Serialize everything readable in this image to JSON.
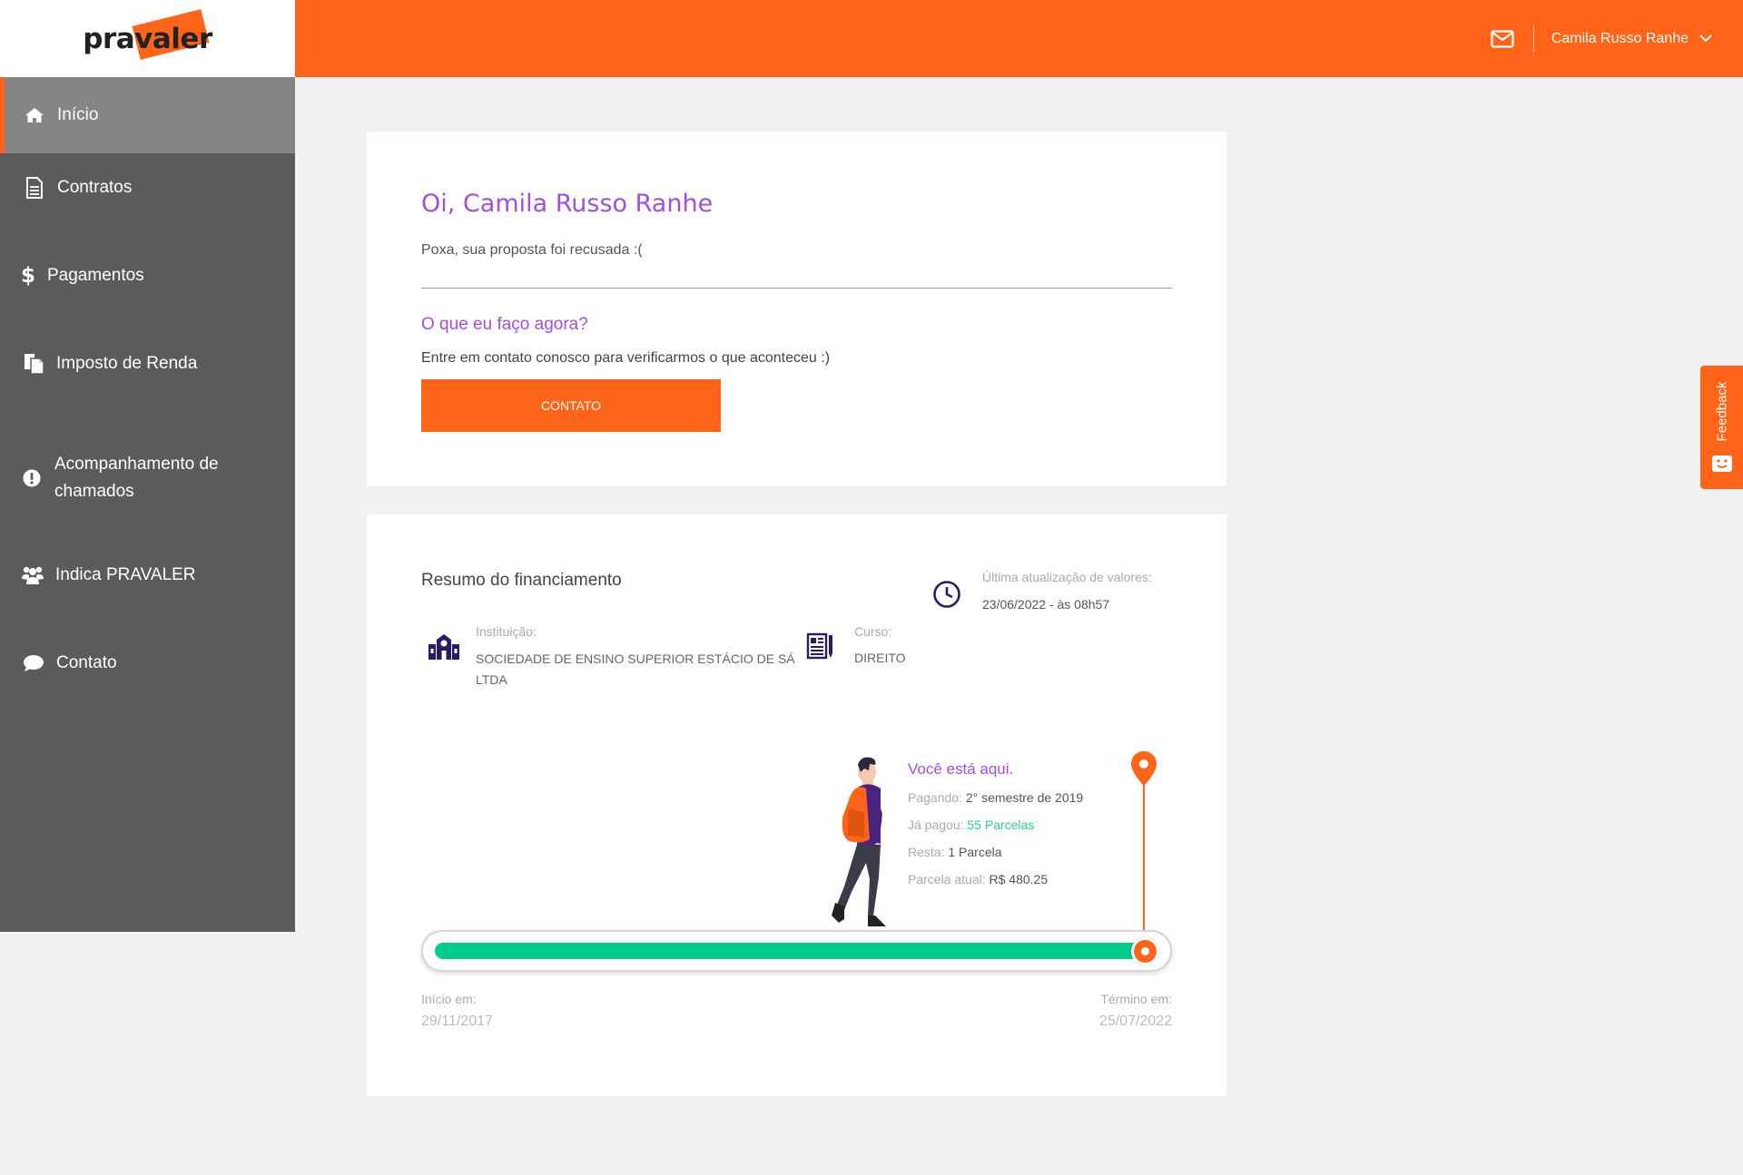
{
  "header": {
    "logo_text": "pravaler",
    "user_name": "Camila Russo Ranhe",
    "icons": {
      "mail": "mail-icon",
      "dropdown": "chevron-down-icon"
    }
  },
  "sidebar": {
    "items": [
      {
        "label": "Início",
        "icon": "home-icon",
        "active": true
      },
      {
        "label": "Contratos",
        "icon": "document-icon",
        "active": false
      },
      {
        "label": "Pagamentos",
        "icon": "dollar-icon",
        "active": false
      },
      {
        "label": "Imposto de Renda",
        "icon": "copy-icon",
        "active": false
      },
      {
        "label": "Acompanhamento de chamados",
        "icon": "alert-icon",
        "active": false
      },
      {
        "label": "Indica PRAVALER",
        "icon": "users-icon",
        "active": false
      },
      {
        "label": "Contato",
        "icon": "chat-icon",
        "active": false
      }
    ]
  },
  "status_card": {
    "greeting": "Oi, Camila Russo Ranhe",
    "message": "Poxa, sua proposta foi recusada :(",
    "question": "O que eu faço agora?",
    "instruction": "Entre em contato conosco para verificarmos o que aconteceu :)",
    "button_label": "CONTATO"
  },
  "summary": {
    "title": "Resumo do financiamento",
    "update_label": "Última atualização de valores:",
    "update_value": "23/06/2022 - às 08h57",
    "institution_label": "Instituição:",
    "institution_value": "SOCIEDADE DE ENSINO SUPERIOR ESTÁCIO DE SÁ LTDA",
    "course_label": "Curso:",
    "course_value": "DIREITO",
    "you_are_here": "Você está aqui.",
    "paying_label": "Pagando:",
    "paying_value": "2° semestre de 2019",
    "paid_label": "Já pagou:",
    "paid_value": "55 Parcelas",
    "remaining_label": "Resta:",
    "remaining_value": "1 Parcela",
    "current_label": "Parcela atual:",
    "current_value": "R$ 480.25",
    "progress_fraction": 0.98,
    "start_label": "Início em:",
    "start_value": "29/11/2017",
    "end_label": "Término em:",
    "end_value": "25/07/2022"
  },
  "feedback": {
    "label": "Feedback"
  },
  "colors": {
    "accent": "#ff6419",
    "purple": "#a14fe0",
    "green": "#00cc8f",
    "sidebar": "#5b5b5b"
  }
}
